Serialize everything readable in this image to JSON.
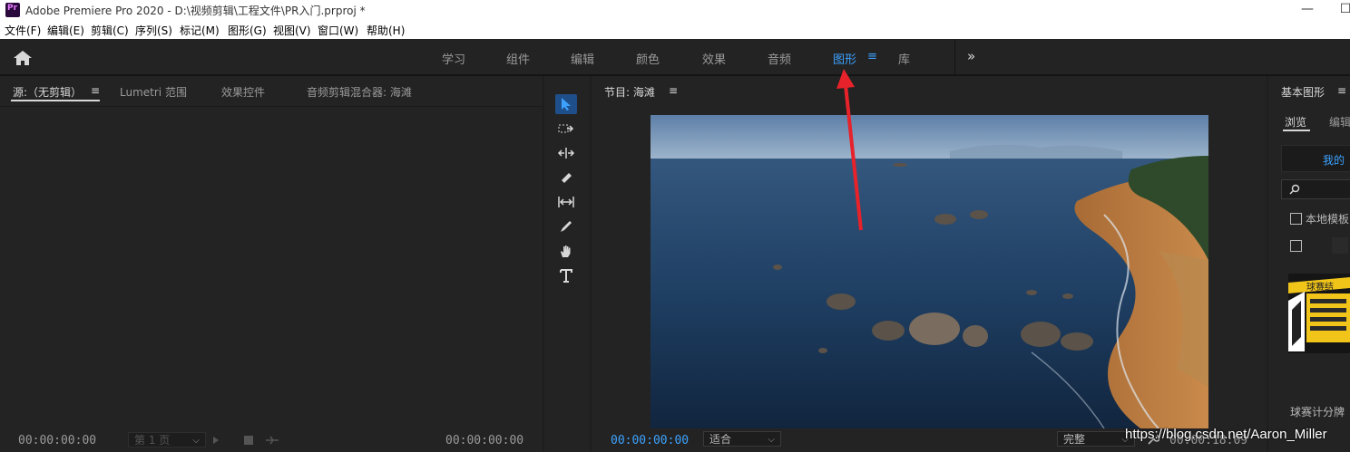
{
  "app": {
    "title": "Adobe Premiere Pro 2020 - D:\\视频剪辑\\工程文件\\PR入门.prproj *",
    "logo_text": "Pr",
    "minimize": "—",
    "maximize": "☐"
  },
  "menu": {
    "items": [
      "文件(F)",
      "编辑(E)",
      "剪辑(C)",
      "序列(S)",
      "标记(M)",
      "图形(G)",
      "视图(V)",
      "窗口(W)",
      "帮助(H)"
    ]
  },
  "workspaces": {
    "tabs": [
      "学习",
      "组件",
      "编辑",
      "颜色",
      "效果",
      "音频",
      "图形",
      "库"
    ],
    "active": "图形",
    "menu_glyph": "≡",
    "overflow_glyph": "»"
  },
  "source_panel": {
    "tabs": [
      "源:（无剪辑）",
      "Lumetri 范围",
      "效果控件",
      "音频剪辑混合器: 海滩"
    ],
    "menu_glyph": "≡",
    "timecode_left": "00:00:00:00",
    "timecode_right": "00:00:00:00",
    "page_select": "第 1 页"
  },
  "program_panel": {
    "title": "节目: 海滩",
    "menu_glyph": "≡",
    "timecode_left": "00:00:00:00",
    "fit_select": "适合",
    "quality_select": "完整",
    "timecode_right": "00:00:18:09"
  },
  "essential_graphics": {
    "title": "基本图形",
    "menu_glyph": "≡",
    "tabs": [
      "浏览",
      "编辑"
    ],
    "active_tab": "浏览",
    "my_templates": "我的",
    "local_templates_label": "本地模板",
    "template_name": "球赛计分牌",
    "template_thumb_text": "球赛结"
  },
  "watermark": "https://blog.csdn.net/Aaron_Miller",
  "colors": {
    "accent": "#3da2ff",
    "annotation_arrow": "#e8222a",
    "panel_bg": "#232323"
  }
}
